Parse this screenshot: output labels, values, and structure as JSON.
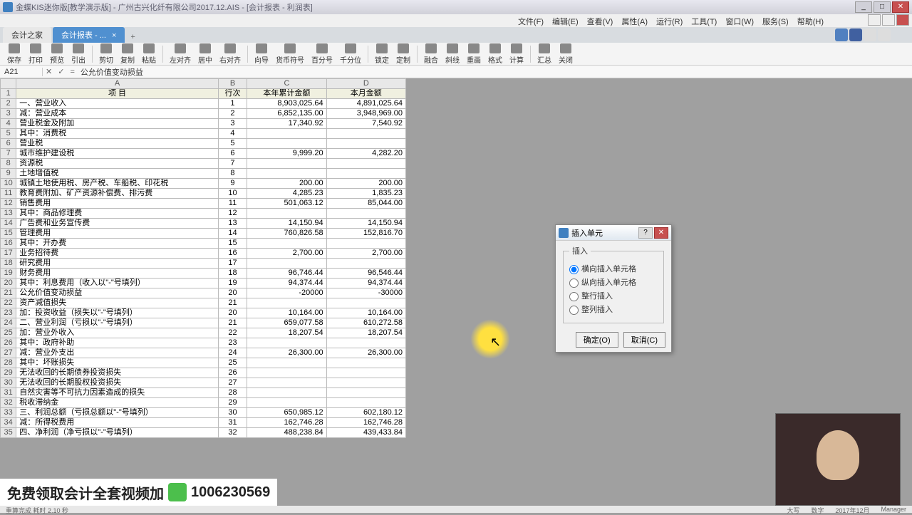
{
  "window": {
    "title": "金蝶KIS迷你版[教学演示版] - 广州古兴化纤有限公司2017.12.AIS - [会计报表 - 利润表]"
  },
  "menus": [
    "文件(F)",
    "编辑(E)",
    "查看(V)",
    "属性(A)",
    "运行(R)",
    "工具(T)",
    "窗口(W)",
    "服务(S)",
    "帮助(H)"
  ],
  "tabs": [
    {
      "label": "会计之家",
      "closable": false
    },
    {
      "label": "会计报表 - ...",
      "closable": true
    }
  ],
  "toolbar": [
    "保存",
    "打印",
    "预览",
    "引出",
    "剪切",
    "复制",
    "粘贴",
    "左对齐",
    "居中",
    "右对齐",
    "向导",
    "货币符号",
    "百分号",
    "千分位",
    "锁定",
    "定制",
    "融合",
    "斜线",
    "重画",
    "格式",
    "计算",
    "汇总",
    "关闭"
  ],
  "fx": {
    "cell": "A21",
    "formula": "公允价值变动损益"
  },
  "cols": [
    "A",
    "B",
    "C",
    "D"
  ],
  "header": {
    "A": "项   目",
    "B": "行次",
    "C": "本年累计金额",
    "D": "本月金额"
  },
  "rows": [
    {
      "n": 2,
      "a": "一、营业收入",
      "b": "1",
      "c": "8,903,025.64",
      "d": "4,891,025.64"
    },
    {
      "n": 3,
      "a": "减：营业成本",
      "b": "2",
      "c": "6,852,135.00",
      "d": "3,948,969.00"
    },
    {
      "n": 4,
      "a": "    营业税金及附加",
      "b": "3",
      "c": "17,340.92",
      "d": "7,540.92"
    },
    {
      "n": 5,
      "a": "        其中：消费税",
      "b": "4",
      "c": "",
      "d": ""
    },
    {
      "n": 6,
      "a": "            营业税",
      "b": "5",
      "c": "",
      "d": ""
    },
    {
      "n": 7,
      "a": "            城市维护建设税",
      "b": "6",
      "c": "9,999.20",
      "d": "4,282.20"
    },
    {
      "n": 8,
      "a": "            资源税",
      "b": "7",
      "c": "",
      "d": ""
    },
    {
      "n": 9,
      "a": "            土地增值税",
      "b": "8",
      "c": "",
      "d": ""
    },
    {
      "n": 10,
      "a": "            城镇土地使用税、房产税、车船税、印花税",
      "b": "9",
      "c": "200.00",
      "d": "200.00"
    },
    {
      "n": 11,
      "a": "            教育费附加、矿产资源补偿费、排污费",
      "b": "10",
      "c": "4,285.23",
      "d": "1,835.23"
    },
    {
      "n": 12,
      "a": "    销售费用",
      "b": "11",
      "c": "501,063.12",
      "d": "85,044.00"
    },
    {
      "n": 13,
      "a": "        其中：商品修理费",
      "b": "12",
      "c": "",
      "d": ""
    },
    {
      "n": 14,
      "a": "            广告费和业务宣传费",
      "b": "13",
      "c": "14,150.94",
      "d": "14,150.94"
    },
    {
      "n": 15,
      "a": "    管理费用",
      "b": "14",
      "c": "760,826.58",
      "d": "152,816.70"
    },
    {
      "n": 16,
      "a": "        其中：开办费",
      "b": "15",
      "c": "",
      "d": ""
    },
    {
      "n": 17,
      "a": "            业务招待费",
      "b": "16",
      "c": "2,700.00",
      "d": "2,700.00"
    },
    {
      "n": 18,
      "a": "            研究费用",
      "b": "17",
      "c": "",
      "d": ""
    },
    {
      "n": 19,
      "a": "    财务费用",
      "b": "18",
      "c": "96,746.44",
      "d": "96,546.44"
    },
    {
      "n": 20,
      "a": "        其中：利息费用（收入以\"-\"号填列）",
      "b": "19",
      "c": "94,374.44",
      "d": "94,374.44"
    },
    {
      "n": 21,
      "a": "公允价值变动损益",
      "b": "20",
      "c": "-20000",
      "d": "-30000",
      "sel": true
    },
    {
      "n": 22,
      "a": "资产减值损失",
      "b": "21",
      "c": "",
      "d": ""
    },
    {
      "n": 23,
      "a": "加：投资收益（损失以\"-\"号填列）",
      "b": "20",
      "c": "10,164.00",
      "d": "10,164.00"
    },
    {
      "n": 24,
      "a": "二、营业利润（亏损以\"-\"号填列）",
      "b": "21",
      "c": "659,077.58",
      "d": "610,272.58"
    },
    {
      "n": 25,
      "a": "加：营业外收入",
      "b": "22",
      "c": "18,207.54",
      "d": "18,207.54"
    },
    {
      "n": 26,
      "a": "        其中：政府补助",
      "b": "23",
      "c": "",
      "d": ""
    },
    {
      "n": 27,
      "a": "减：营业外支出",
      "b": "24",
      "c": "26,300.00",
      "d": "26,300.00"
    },
    {
      "n": 28,
      "a": "        其中：坏账损失",
      "b": "25",
      "c": "",
      "d": ""
    },
    {
      "n": 29,
      "a": "            无法收回的长期债券投资损失",
      "b": "26",
      "c": "",
      "d": ""
    },
    {
      "n": 30,
      "a": "            无法收回的长期股权投资损失",
      "b": "27",
      "c": "",
      "d": ""
    },
    {
      "n": 31,
      "a": "            自然灾害等不可抗力因素造成的损失",
      "b": "28",
      "c": "",
      "d": ""
    },
    {
      "n": 32,
      "a": "            税收滞纳金",
      "b": "29",
      "c": "",
      "d": ""
    },
    {
      "n": 33,
      "a": "三、利润总额（亏损总额以\"-\"号填列）",
      "b": "30",
      "c": "650,985.12",
      "d": "602,180.12"
    },
    {
      "n": 34,
      "a": "减：所得税费用",
      "b": "31",
      "c": "162,746.28",
      "d": "162,746.28"
    },
    {
      "n": 35,
      "a": "四、净利润（净亏损以\"-\"号填列）",
      "b": "32",
      "c": "488,238.84",
      "d": "439,433.84"
    }
  ],
  "dialog": {
    "title": "插入单元",
    "group": "插入",
    "options": [
      "横向插入单元格",
      "纵向插入单元格",
      "整行插入",
      "整列插入"
    ],
    "ok": "确定(O)",
    "cancel": "取消(C)"
  },
  "banner": {
    "text": "免费领取会计全套视频加",
    "code": "1006230569"
  },
  "status": {
    "left": "重算完成  耗时 2.10 秒",
    "r1": "大写",
    "r2": "数字",
    "r3": "2017年12月",
    "r4": "Manager"
  }
}
